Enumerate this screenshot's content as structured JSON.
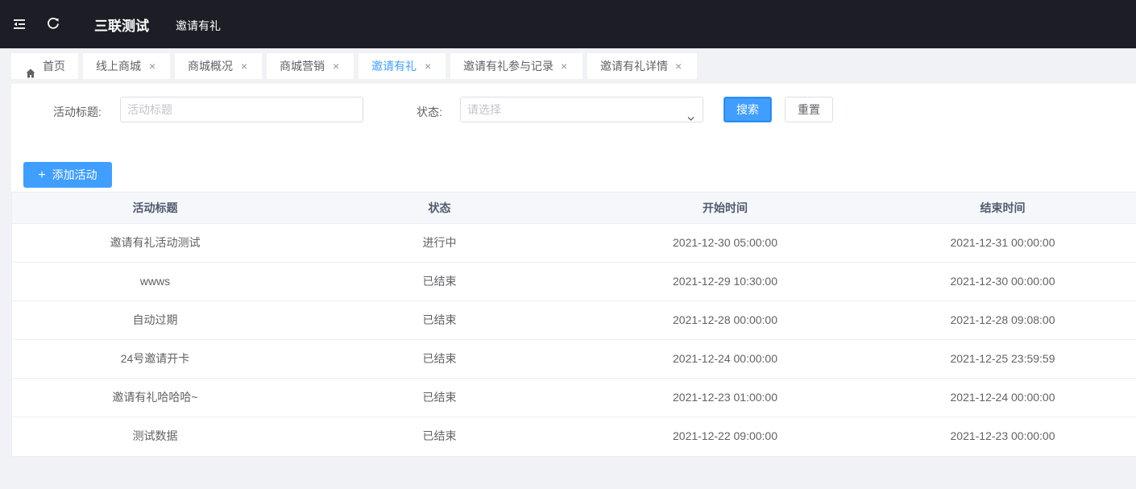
{
  "header": {
    "app_title": "三联测试",
    "breadcrumb": "邀请有礼"
  },
  "tabs": [
    {
      "label": "首页",
      "icon": "home-icon",
      "closable": false,
      "active": false
    },
    {
      "label": "线上商城",
      "closable": true,
      "active": false
    },
    {
      "label": "商城概况",
      "closable": true,
      "active": false
    },
    {
      "label": "商城营销",
      "closable": true,
      "active": false
    },
    {
      "label": "邀请有礼",
      "closable": true,
      "active": true
    },
    {
      "label": "邀请有礼参与记录",
      "closable": true,
      "active": false
    },
    {
      "label": "邀请有礼详情",
      "closable": true,
      "active": false
    }
  ],
  "tab_close_glyph": "×",
  "filters": {
    "title_label": "活动标题:",
    "title_placeholder": "活动标题",
    "status_label": "状态:",
    "status_placeholder": "请选择",
    "search_label": "搜索",
    "reset_label": "重置"
  },
  "add_button_label": "添加活动",
  "table": {
    "headers": [
      "活动标题",
      "状态",
      "开始时间",
      "结束时间"
    ],
    "rows": [
      [
        "邀请有礼活动测试",
        "进行中",
        "2021-12-30 05:00:00",
        "2021-12-31 00:00:00"
      ],
      [
        "wwws",
        "已结束",
        "2021-12-29 10:30:00",
        "2021-12-30 00:00:00"
      ],
      [
        "自动过期",
        "已结束",
        "2021-12-28 00:00:00",
        "2021-12-28 09:08:00"
      ],
      [
        "24号邀请开卡",
        "已结束",
        "2021-12-24 00:00:00",
        "2021-12-25 23:59:59"
      ],
      [
        "邀请有礼哈哈哈~",
        "已结束",
        "2021-12-23 01:00:00",
        "2021-12-24 00:00:00"
      ],
      [
        "测试数据",
        "已结束",
        "2021-12-22 09:00:00",
        "2021-12-23 00:00:00"
      ]
    ]
  },
  "colors": {
    "topbar": "#1d1e25",
    "primary": "#409eff",
    "page_bg": "#f0f2f5"
  }
}
